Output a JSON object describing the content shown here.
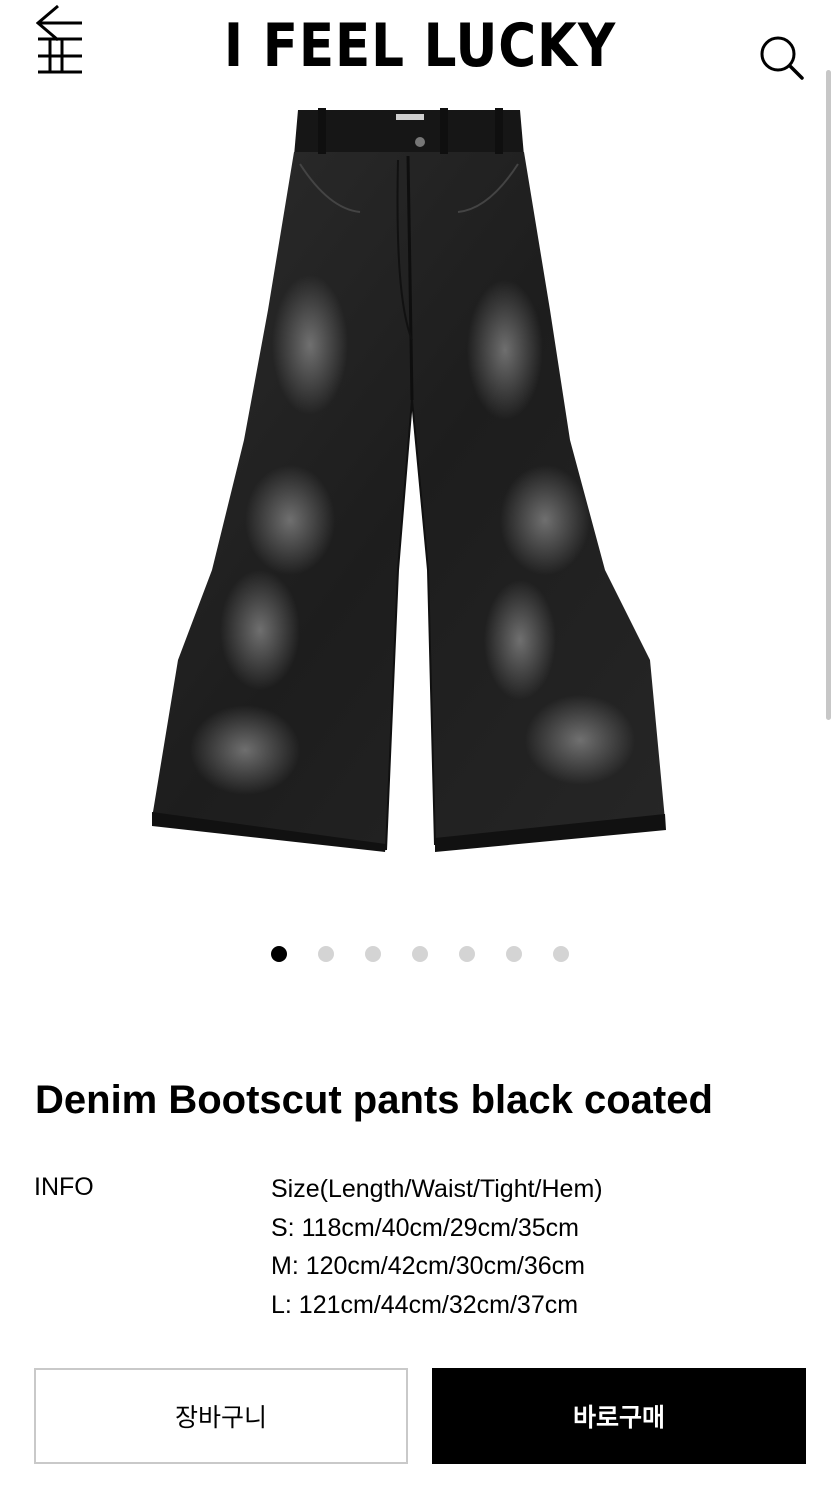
{
  "header": {
    "logo": "I FEEL LUCKY",
    "menu_icon": "menu-back-icon",
    "search_icon": "search-icon"
  },
  "product": {
    "image": "black flared denim bootcut pants",
    "image_count": 7,
    "active_image": 1,
    "title": "Denim Bootscut pants black coated",
    "info_label": "INFO",
    "info_lines": [
      "Size(Length/Waist/Tight/Hem)",
      "S: 118cm/40cm/29cm/35cm",
      "M: 120cm/42cm/30cm/36cm",
      "L: 121cm/44cm/32cm/37cm"
    ]
  },
  "actions": {
    "cart_label": "장바구니",
    "buy_label": "바로구매"
  },
  "colors": {
    "primary": "#000000",
    "background": "#ffffff",
    "dot_inactive": "#d4d4d4",
    "cart_border": "#c9c9c9"
  }
}
